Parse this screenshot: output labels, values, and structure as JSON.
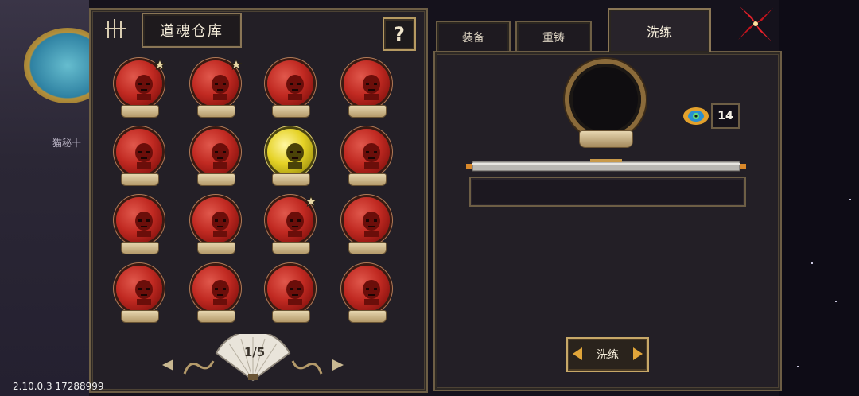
{
  "panel": {
    "title": "道魂仓库",
    "help_label": "?",
    "page_indicator": "1/5"
  },
  "tabs": [
    {
      "label": "装备",
      "active": false
    },
    {
      "label": "重铸",
      "active": false
    },
    {
      "label": "洗练",
      "active": true
    }
  ],
  "souls": [
    {
      "color": "red",
      "starred": true
    },
    {
      "color": "red",
      "starred": true
    },
    {
      "color": "red",
      "starred": false
    },
    {
      "color": "red",
      "starred": false
    },
    {
      "color": "red",
      "starred": false
    },
    {
      "color": "red",
      "starred": false
    },
    {
      "color": "gold",
      "starred": false
    },
    {
      "color": "red",
      "starred": false
    },
    {
      "color": "red",
      "starred": false
    },
    {
      "color": "red",
      "starred": false
    },
    {
      "color": "red",
      "starred": true
    },
    {
      "color": "red",
      "starred": false
    },
    {
      "color": "red",
      "starred": false
    },
    {
      "color": "red",
      "starred": false
    },
    {
      "color": "red",
      "starred": false
    },
    {
      "color": "red",
      "starred": false
    }
  ],
  "refine": {
    "gem_count": "14",
    "button_label": "洗练"
  },
  "background": {
    "npc_label": "猫秘十"
  },
  "version": "2.10.0.3 17288999",
  "colors": {
    "soul_red": "#c12a22",
    "soul_gold": "#e5d226",
    "frame_gold": "#8a7656",
    "panel_bg": "#231f26"
  }
}
